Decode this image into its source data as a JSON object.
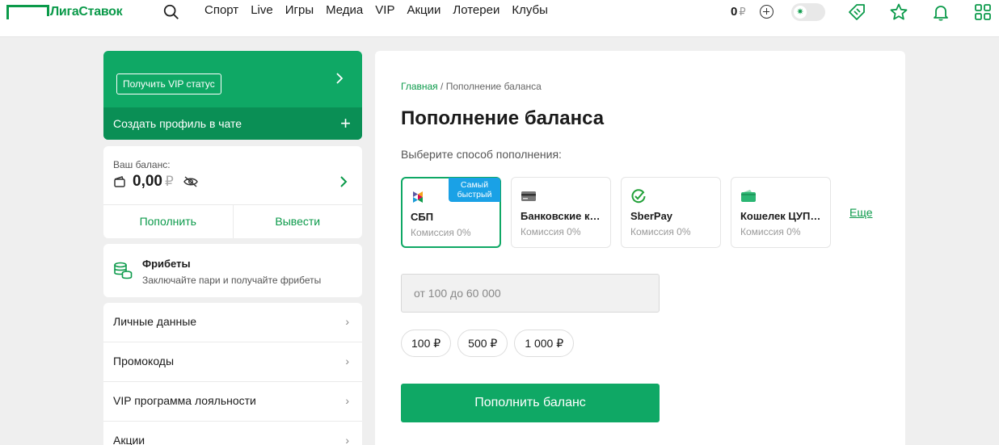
{
  "header": {
    "logo_text": "ЛигаСтавок",
    "nav": [
      "Спорт",
      "Live",
      "Игры",
      "Медиа",
      "VIP",
      "Акции",
      "Лотереи",
      "Клубы"
    ],
    "balance": "0",
    "currency": "₽",
    "accent": "#0b9a4a"
  },
  "sidebar": {
    "vip_button": "Получить VIP статус",
    "chat_profile": "Создать профиль в чате",
    "balance_label": "Ваш баланс:",
    "balance_value": "0,00",
    "balance_currency": "₽",
    "deposit": "Пополнить",
    "withdraw": "Вывести",
    "freebets_title": "Фрибеты",
    "freebets_sub": "Заключайте пари и получайте фрибеты",
    "menu": [
      "Личные данные",
      "Промокоды",
      "VIP программа лояльности",
      "Акции"
    ]
  },
  "main": {
    "breadcrumb_home": "Главная",
    "breadcrumb_sep": "/",
    "breadcrumb_current": "Пополнение баланса",
    "title": "Пополнение баланса",
    "subtitle": "Выберите способ пополнения:",
    "methods": [
      {
        "name": "СБП",
        "fee": "Комиссия 0%",
        "badge": "Самый быстрый",
        "icon": "sbp-icon"
      },
      {
        "name": "Банковские карты",
        "fee": "Комиссия 0%",
        "icon": "card-icon"
      },
      {
        "name": "SberPay",
        "fee": "Комиссия 0%",
        "icon": "sberpay-icon"
      },
      {
        "name": "Кошелек ЦУПИС",
        "fee": "Комиссия 0%",
        "icon": "wallet-icon"
      }
    ],
    "more": "Еще",
    "amount_placeholder": "от 100 до 60 000",
    "chips": [
      "100 ₽",
      "500 ₽",
      "1 000 ₽"
    ],
    "submit": "Пополнить баланс",
    "badge_color": "#1aa1e6",
    "button_color": "#0fa865"
  }
}
